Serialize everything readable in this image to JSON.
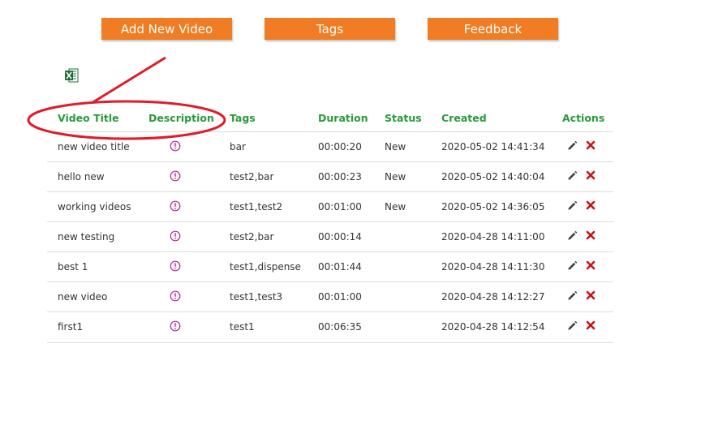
{
  "toolbar": {
    "add_label": "Add New Video",
    "tags_label": "Tags",
    "feedback_label": "Feedback"
  },
  "export": {
    "icon": "excel-icon"
  },
  "colors": {
    "button": "#f07c23",
    "header": "#2a9a3a",
    "info_icon": "#b02a9a",
    "delete_icon": "#cc1111",
    "annotation": "#e01b2a"
  },
  "table": {
    "headers": [
      "Video Title",
      "Description",
      "Tags",
      "Duration",
      "Status",
      "Created",
      "Actions"
    ],
    "rows": [
      {
        "title": "new video title",
        "tags": "bar",
        "duration": "00:00:20",
        "status": "New",
        "created": "2020-05-02 14:41:34"
      },
      {
        "title": "hello new",
        "tags": "test2,bar",
        "duration": "00:00:23",
        "status": "New",
        "created": "2020-05-02 14:40:04"
      },
      {
        "title": "working videos",
        "tags": "test1,test2",
        "duration": "00:01:00",
        "status": "New",
        "created": "2020-05-02 14:36:05"
      },
      {
        "title": "new testing",
        "tags": "test2,bar",
        "duration": "00:00:14",
        "status": "",
        "created": "2020-04-28 14:11:00"
      },
      {
        "title": "best 1",
        "tags": "test1,dispense",
        "duration": "00:01:44",
        "status": "",
        "created": "2020-04-28 14:11:30"
      },
      {
        "title": "new video",
        "tags": "test1,test3",
        "duration": "00:01:00",
        "status": "",
        "created": "2020-04-28 14:12:27"
      },
      {
        "title": "first1",
        "tags": "test1",
        "duration": "00:06:35",
        "status": "",
        "created": "2020-04-28 14:12:54"
      }
    ]
  }
}
